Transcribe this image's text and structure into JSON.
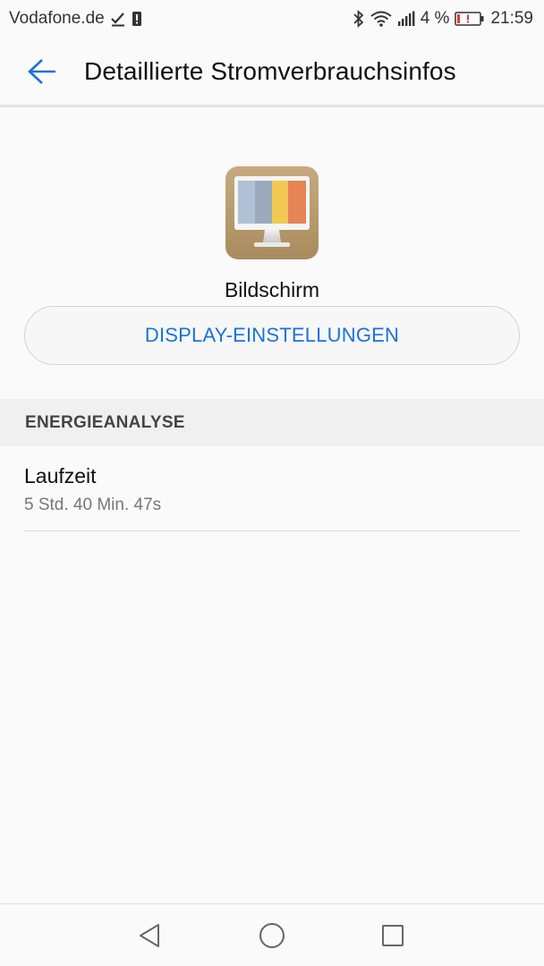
{
  "status_bar": {
    "carrier": "Vodafone.de",
    "battery_percent": "4 %",
    "time": "21:59",
    "icons": [
      "download-done-icon",
      "sim-alert-icon",
      "bluetooth-icon",
      "wifi-icon",
      "signal-icon",
      "battery-low-icon"
    ],
    "battery_alert_color": "#e53935"
  },
  "app_bar": {
    "title": "Detaillierte Stromverbrauchsinfos",
    "back_icon": "arrow-left-icon",
    "accent_color": "#1a73d9"
  },
  "app": {
    "name": "Bildschirm",
    "icon": "display-monitor-icon",
    "settings_button_label": "DISPLAY-EINSTELLUNGEN"
  },
  "energy_section": {
    "header": "ENERGIEANALYSE",
    "items": [
      {
        "title": "Laufzeit",
        "value": "5 Std. 40 Min. 47s"
      }
    ]
  },
  "nav_bar": {
    "icons": [
      "triangle-back-icon",
      "circle-home-icon",
      "square-recents-icon"
    ]
  }
}
